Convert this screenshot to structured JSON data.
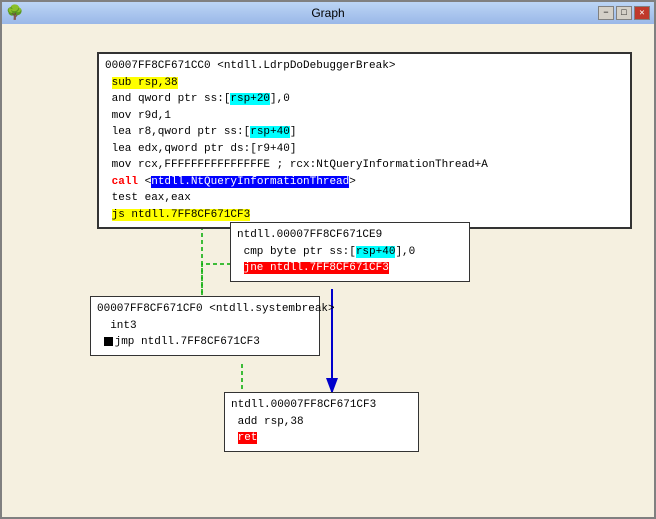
{
  "window": {
    "title": "Graph",
    "titlebar": {
      "minimize_label": "−",
      "maximize_label": "□",
      "close_label": "✕"
    }
  },
  "nodes": {
    "top": {
      "lines": [
        {
          "type": "addr",
          "text": "00007FF8CF671CC0 <ntdll.LdrpDoDebuggerBreak>"
        },
        {
          "type": "hl-yellow",
          "text": " sub rsp,38"
        },
        {
          "type": "normal-hl-cyan",
          "text": " and qword ptr ss:[rsp+20],0"
        },
        {
          "type": "normal",
          "text": " mov r9d,1"
        },
        {
          "type": "normal-hl-cyan",
          "text": " lea r8,qword ptr ss:[rsp+40]"
        },
        {
          "type": "normal-hl-cyan",
          "text": " lea edx,qword ptr ds:[r9+40]"
        },
        {
          "type": "normal",
          "text": " mov rcx,FFFFFFFFFFFFFFFE ; rcx:NtQueryInformationThread+A"
        },
        {
          "type": "call-blue",
          "text": " call <ntdll.NtQueryInformationThread>"
        },
        {
          "type": "normal",
          "text": " test eax,eax"
        },
        {
          "type": "js-yellow",
          "text": " js ntdll.7FF8CF671CF3"
        }
      ]
    },
    "middle_right": {
      "lines": [
        {
          "type": "addr",
          "text": "ntdll.00007FF8CF671CE9"
        },
        {
          "type": "normal-hl-cyan",
          "text": " cmp byte ptr ss:[rsp+40],0"
        },
        {
          "type": "jne-red",
          "text": " jne ntdll.7FF8CF671CF3"
        }
      ]
    },
    "middle_left": {
      "lines": [
        {
          "type": "addr",
          "text": "00007FF8CF671CF0 <ntdll.systembreak>"
        },
        {
          "type": "normal",
          "text": "  int3"
        },
        {
          "type": "sq-black-jmp",
          "text": " jmp ntdll.7FF8CF671CF3"
        }
      ]
    },
    "bottom": {
      "lines": [
        {
          "type": "addr",
          "text": "ntdll.00007FF8CF671CF3"
        },
        {
          "type": "normal",
          "text": " add rsp,38"
        },
        {
          "type": "sq-red-ret",
          "text": " ret"
        }
      ]
    }
  },
  "colors": {
    "arrow_red": "#ff0000",
    "arrow_green": "#00c000",
    "arrow_blue": "#0000aa",
    "node_border_dashed": "#00c000"
  }
}
